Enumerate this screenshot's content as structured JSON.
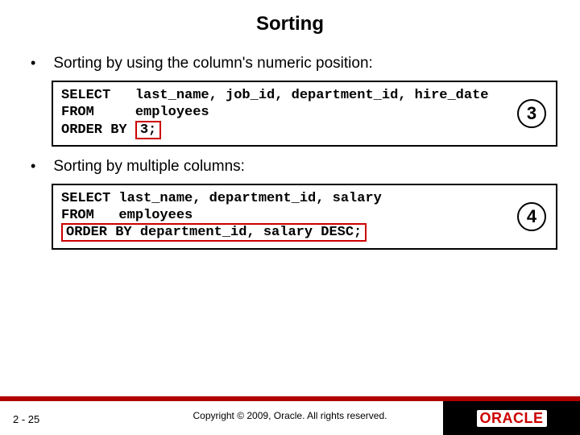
{
  "title": "Sorting",
  "bullets": [
    "Sorting by using the column's numeric position:",
    "Sorting by multiple columns:"
  ],
  "code1": {
    "pre": "SELECT   last_name, job_id, department_id, hire_date\nFROM     employees\nORDER BY ",
    "highlight": "3;",
    "badge": "3"
  },
  "code2": {
    "line1": "SELECT last_name, department_id, salary",
    "line2": "FROM   employees",
    "highlight": "ORDER BY department_id, salary DESC;",
    "badge": "4"
  },
  "footer": {
    "page": "2 - 25",
    "copyright": "Copyright © 2009, Oracle. All rights reserved.",
    "brand": "ORACLE"
  }
}
